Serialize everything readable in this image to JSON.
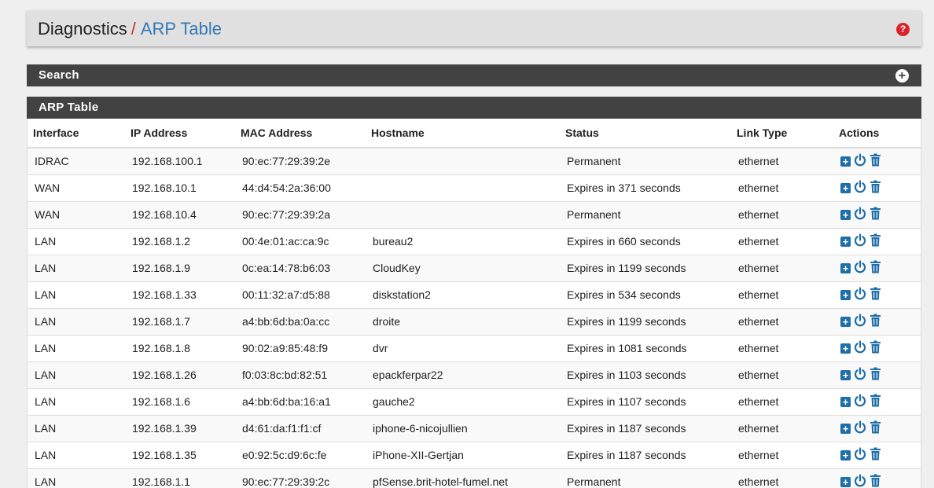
{
  "header": {
    "root": "Diagnostics",
    "separator": "/",
    "current": "ARP Table",
    "help_icon": "help-icon"
  },
  "search_panel": {
    "title": "Search",
    "toggle_icon": "plus-circle-icon"
  },
  "arp_panel": {
    "title": "ARP Table"
  },
  "table": {
    "columns": [
      "Interface",
      "IP Address",
      "MAC Address",
      "Hostname",
      "Status",
      "Link Type",
      "Actions"
    ],
    "rows": [
      {
        "interface": "IDRAC",
        "ip": "192.168.100.1",
        "mac": "90:ec:77:29:39:2e",
        "hostname": "",
        "status": "Permanent",
        "link": "ethernet"
      },
      {
        "interface": "WAN",
        "ip": "192.168.10.1",
        "mac": "44:d4:54:2a:36:00",
        "hostname": "",
        "status": "Expires in 371 seconds",
        "link": "ethernet"
      },
      {
        "interface": "WAN",
        "ip": "192.168.10.4",
        "mac": "90:ec:77:29:39:2a",
        "hostname": "",
        "status": "Permanent",
        "link": "ethernet"
      },
      {
        "interface": "LAN",
        "ip": "192.168.1.2",
        "mac": "00:4e:01:ac:ca:9c",
        "hostname": "bureau2",
        "status": "Expires in 660 seconds",
        "link": "ethernet"
      },
      {
        "interface": "LAN",
        "ip": "192.168.1.9",
        "mac": "0c:ea:14:78:b6:03",
        "hostname": "CloudKey",
        "status": "Expires in 1199 seconds",
        "link": "ethernet"
      },
      {
        "interface": "LAN",
        "ip": "192.168.1.33",
        "mac": "00:11:32:a7:d5:88",
        "hostname": "diskstation2",
        "status": "Expires in 534 seconds",
        "link": "ethernet"
      },
      {
        "interface": "LAN",
        "ip": "192.168.1.7",
        "mac": "a4:bb:6d:ba:0a:cc",
        "hostname": "droite",
        "status": "Expires in 1199 seconds",
        "link": "ethernet"
      },
      {
        "interface": "LAN",
        "ip": "192.168.1.8",
        "mac": "90:02:a9:85:48:f9",
        "hostname": "dvr",
        "status": "Expires in 1081 seconds",
        "link": "ethernet"
      },
      {
        "interface": "LAN",
        "ip": "192.168.1.26",
        "mac": "f0:03:8c:bd:82:51",
        "hostname": "epackferpar22",
        "status": "Expires in 1103 seconds",
        "link": "ethernet"
      },
      {
        "interface": "LAN",
        "ip": "192.168.1.6",
        "mac": "a4:bb:6d:ba:16:a1",
        "hostname": "gauche2",
        "status": "Expires in 1107 seconds",
        "link": "ethernet"
      },
      {
        "interface": "LAN",
        "ip": "192.168.1.39",
        "mac": "d4:61:da:f1:f1:cf",
        "hostname": "iphone-6-nicojullien",
        "status": "Expires in 1187 seconds",
        "link": "ethernet"
      },
      {
        "interface": "LAN",
        "ip": "192.168.1.35",
        "mac": "e0:92:5c:d9:6c:fe",
        "hostname": "iPhone-XII-Gertjan",
        "status": "Expires in 1187 seconds",
        "link": "ethernet"
      },
      {
        "interface": "LAN",
        "ip": "192.168.1.1",
        "mac": "90:ec:77:29:39:2c",
        "hostname": "pfSense.brit-hotel-fumel.net",
        "status": "Permanent",
        "link": "ethernet"
      }
    ],
    "action_icons": [
      "add-static-mapping-icon",
      "wake-on-lan-icon",
      "delete-icon"
    ]
  },
  "colors": {
    "accent_blue": "#337ab7",
    "separator_red": "#c9302c",
    "panel_dark": "#424242",
    "action_blue": "#1e6ea8"
  }
}
